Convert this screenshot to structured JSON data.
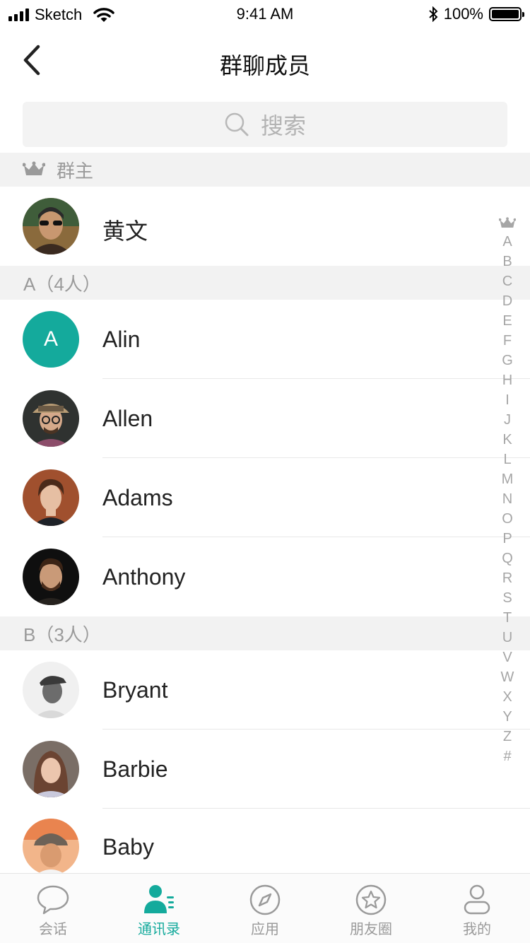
{
  "status_bar": {
    "carrier": "Sketch",
    "time": "9:41 AM",
    "battery": "100%",
    "battery_level": 1.0
  },
  "nav": {
    "title": "群聊成员"
  },
  "search": {
    "placeholder": "搜索"
  },
  "owner_section": {
    "label": "群主",
    "member": {
      "name": "黄文",
      "avatar": "photo"
    }
  },
  "sections": [
    {
      "label": "A（4人）",
      "members": [
        {
          "name": "Alin",
          "avatar_letter": "A"
        },
        {
          "name": "Allen",
          "avatar": "photo"
        },
        {
          "name": "Adams",
          "avatar": "photo"
        },
        {
          "name": "Anthony",
          "avatar": "photo"
        }
      ]
    },
    {
      "label": "B（3人）",
      "members": [
        {
          "name": "Bryant",
          "avatar": "photo"
        },
        {
          "name": "Barbie",
          "avatar": "photo"
        },
        {
          "name": "Baby",
          "avatar": "photo"
        }
      ]
    }
  ],
  "index_bar": [
    "A",
    "B",
    "C",
    "D",
    "E",
    "F",
    "G",
    "H",
    "I",
    "J",
    "K",
    "L",
    "M",
    "N",
    "O",
    "P",
    "Q",
    "R",
    "S",
    "T",
    "U",
    "V",
    "W",
    "X",
    "Y",
    "Z",
    "#"
  ],
  "tabbar": [
    {
      "label": "会话",
      "icon": "chat-bubble-icon",
      "active": false
    },
    {
      "label": "通讯录",
      "icon": "contacts-icon",
      "active": true
    },
    {
      "label": "应用",
      "icon": "compass-icon",
      "active": false
    },
    {
      "label": "朋友圈",
      "icon": "star-circle-icon",
      "active": false
    },
    {
      "label": "我的",
      "icon": "profile-icon",
      "active": false
    }
  ],
  "colors": {
    "accent": "#14aa9c",
    "section_bg": "#f2f2f2",
    "muted_text": "#9a9a9a"
  }
}
